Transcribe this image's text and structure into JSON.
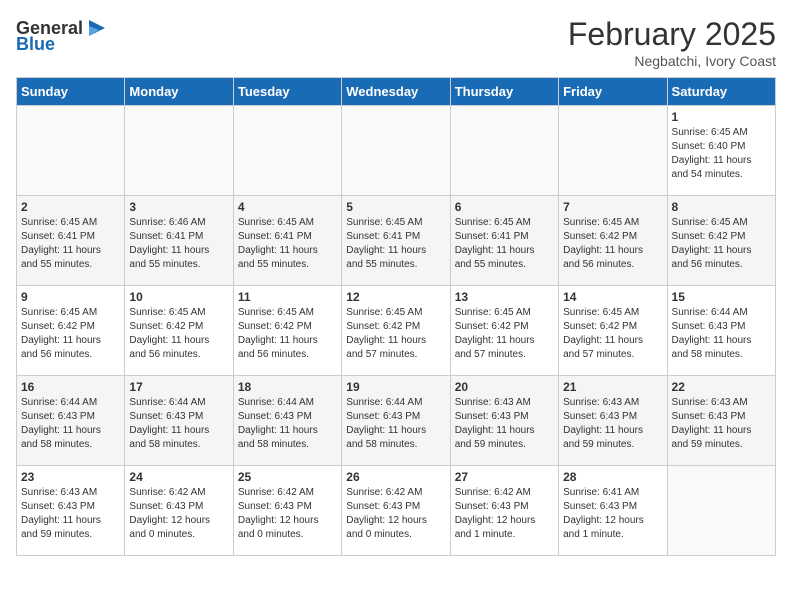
{
  "header": {
    "logo_general": "General",
    "logo_blue": "Blue",
    "month_title": "February 2025",
    "location": "Negbatchi, Ivory Coast"
  },
  "days_of_week": [
    "Sunday",
    "Monday",
    "Tuesday",
    "Wednesday",
    "Thursday",
    "Friday",
    "Saturday"
  ],
  "weeks": [
    [
      {
        "day": "",
        "info": ""
      },
      {
        "day": "",
        "info": ""
      },
      {
        "day": "",
        "info": ""
      },
      {
        "day": "",
        "info": ""
      },
      {
        "day": "",
        "info": ""
      },
      {
        "day": "",
        "info": ""
      },
      {
        "day": "1",
        "info": "Sunrise: 6:45 AM\nSunset: 6:40 PM\nDaylight: 11 hours\nand 54 minutes."
      }
    ],
    [
      {
        "day": "2",
        "info": "Sunrise: 6:45 AM\nSunset: 6:41 PM\nDaylight: 11 hours\nand 55 minutes."
      },
      {
        "day": "3",
        "info": "Sunrise: 6:46 AM\nSunset: 6:41 PM\nDaylight: 11 hours\nand 55 minutes."
      },
      {
        "day": "4",
        "info": "Sunrise: 6:45 AM\nSunset: 6:41 PM\nDaylight: 11 hours\nand 55 minutes."
      },
      {
        "day": "5",
        "info": "Sunrise: 6:45 AM\nSunset: 6:41 PM\nDaylight: 11 hours\nand 55 minutes."
      },
      {
        "day": "6",
        "info": "Sunrise: 6:45 AM\nSunset: 6:41 PM\nDaylight: 11 hours\nand 55 minutes."
      },
      {
        "day": "7",
        "info": "Sunrise: 6:45 AM\nSunset: 6:42 PM\nDaylight: 11 hours\nand 56 minutes."
      },
      {
        "day": "8",
        "info": "Sunrise: 6:45 AM\nSunset: 6:42 PM\nDaylight: 11 hours\nand 56 minutes."
      }
    ],
    [
      {
        "day": "9",
        "info": "Sunrise: 6:45 AM\nSunset: 6:42 PM\nDaylight: 11 hours\nand 56 minutes."
      },
      {
        "day": "10",
        "info": "Sunrise: 6:45 AM\nSunset: 6:42 PM\nDaylight: 11 hours\nand 56 minutes."
      },
      {
        "day": "11",
        "info": "Sunrise: 6:45 AM\nSunset: 6:42 PM\nDaylight: 11 hours\nand 56 minutes."
      },
      {
        "day": "12",
        "info": "Sunrise: 6:45 AM\nSunset: 6:42 PM\nDaylight: 11 hours\nand 57 minutes."
      },
      {
        "day": "13",
        "info": "Sunrise: 6:45 AM\nSunset: 6:42 PM\nDaylight: 11 hours\nand 57 minutes."
      },
      {
        "day": "14",
        "info": "Sunrise: 6:45 AM\nSunset: 6:42 PM\nDaylight: 11 hours\nand 57 minutes."
      },
      {
        "day": "15",
        "info": "Sunrise: 6:44 AM\nSunset: 6:43 PM\nDaylight: 11 hours\nand 58 minutes."
      }
    ],
    [
      {
        "day": "16",
        "info": "Sunrise: 6:44 AM\nSunset: 6:43 PM\nDaylight: 11 hours\nand 58 minutes."
      },
      {
        "day": "17",
        "info": "Sunrise: 6:44 AM\nSunset: 6:43 PM\nDaylight: 11 hours\nand 58 minutes."
      },
      {
        "day": "18",
        "info": "Sunrise: 6:44 AM\nSunset: 6:43 PM\nDaylight: 11 hours\nand 58 minutes."
      },
      {
        "day": "19",
        "info": "Sunrise: 6:44 AM\nSunset: 6:43 PM\nDaylight: 11 hours\nand 58 minutes."
      },
      {
        "day": "20",
        "info": "Sunrise: 6:43 AM\nSunset: 6:43 PM\nDaylight: 11 hours\nand 59 minutes."
      },
      {
        "day": "21",
        "info": "Sunrise: 6:43 AM\nSunset: 6:43 PM\nDaylight: 11 hours\nand 59 minutes."
      },
      {
        "day": "22",
        "info": "Sunrise: 6:43 AM\nSunset: 6:43 PM\nDaylight: 11 hours\nand 59 minutes."
      }
    ],
    [
      {
        "day": "23",
        "info": "Sunrise: 6:43 AM\nSunset: 6:43 PM\nDaylight: 11 hours\nand 59 minutes."
      },
      {
        "day": "24",
        "info": "Sunrise: 6:42 AM\nSunset: 6:43 PM\nDaylight: 12 hours\nand 0 minutes."
      },
      {
        "day": "25",
        "info": "Sunrise: 6:42 AM\nSunset: 6:43 PM\nDaylight: 12 hours\nand 0 minutes."
      },
      {
        "day": "26",
        "info": "Sunrise: 6:42 AM\nSunset: 6:43 PM\nDaylight: 12 hours\nand 0 minutes."
      },
      {
        "day": "27",
        "info": "Sunrise: 6:42 AM\nSunset: 6:43 PM\nDaylight: 12 hours\nand 1 minute."
      },
      {
        "day": "28",
        "info": "Sunrise: 6:41 AM\nSunset: 6:43 PM\nDaylight: 12 hours\nand 1 minute."
      },
      {
        "day": "",
        "info": ""
      }
    ]
  ]
}
